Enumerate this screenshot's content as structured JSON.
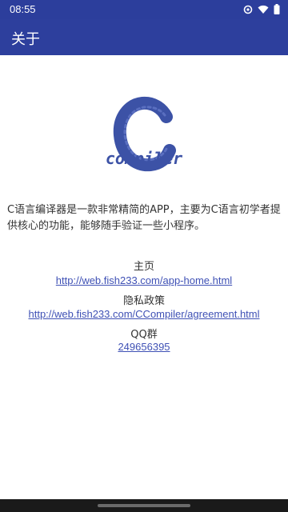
{
  "status_bar": {
    "time": "08:55",
    "icons": [
      "data-saver-icon",
      "wifi-icon",
      "battery-icon"
    ]
  },
  "app_bar": {
    "title": "关于"
  },
  "logo": {
    "text": "compiler",
    "letter": "C",
    "color": "#3c52a6"
  },
  "description": "C语言编译器是一款非常精简的APP，主要为C语言初学者提供核心的功能，能够随手验证一些小程序。",
  "sections": {
    "home": {
      "label": "主页",
      "link": "http://web.fish233.com/app-home.html"
    },
    "privacy": {
      "label": "隐私政策",
      "link": "http://web.fish233.com/CCompiler/agreement.html"
    },
    "qq": {
      "label": "QQ群",
      "link": "249656395"
    }
  },
  "colors": {
    "primary": "#2d3f9d",
    "link": "#3f51b5"
  }
}
